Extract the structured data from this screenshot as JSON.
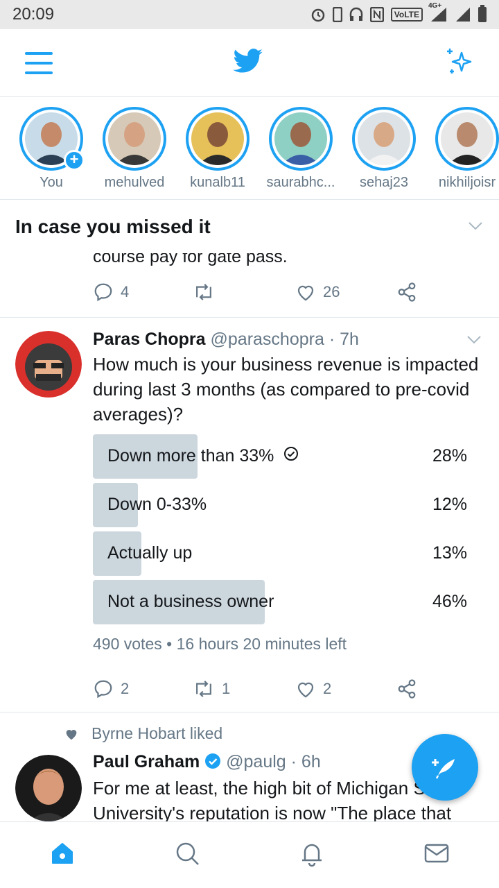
{
  "status_bar": {
    "time": "20:09",
    "network": "4G+",
    "volte": "VoLTE"
  },
  "fleets": [
    {
      "name": "You",
      "has_add": true,
      "ring": "#1da1f2",
      "bg": "#c8dbe8",
      "skin": "#c48a6a",
      "shirt": "#2b3f55"
    },
    {
      "name": "mehulved",
      "has_add": false,
      "ring": "#1da1f2",
      "bg": "#d6c9b7",
      "skin": "#d5a383",
      "shirt": "#383838"
    },
    {
      "name": "kunalb11",
      "has_add": false,
      "ring": "#1da1f2",
      "bg": "#e6c15a",
      "skin": "#8a5a3c",
      "shirt": "#2a2a2a"
    },
    {
      "name": "saurabhc...",
      "has_add": false,
      "ring": "#1da1f2",
      "bg": "#8fd0c5",
      "skin": "#9a6a4f",
      "shirt": "#3b5fa7"
    },
    {
      "name": "sehaj23",
      "has_add": false,
      "ring": "#1da1f2",
      "bg": "#dde2e6",
      "skin": "#d8a987",
      "shirt": "#f2f2f2"
    },
    {
      "name": "nikhiljoisr",
      "has_add": false,
      "ring": "#1da1f2",
      "bg": "#e8e8e8",
      "skin": "#b98a6d",
      "shirt": "#222222"
    }
  ],
  "icymi": {
    "title": "In case you missed it"
  },
  "prev_tweet": {
    "text_fragment": "course pay for gate pass.",
    "replies": "4",
    "retweets": "",
    "likes": "26"
  },
  "poll_tweet": {
    "name": "Paras Chopra",
    "handle": "@paraschopra",
    "time": "· 7h",
    "text": "How much is your business revenue is impacted during last 3 months (as compared to pre-covid averages)?",
    "options": [
      {
        "label": "Down more than 33%",
        "pct": "28%",
        "fraction": 0.28,
        "winner": true
      },
      {
        "label": "Down 0-33%",
        "pct": "12%",
        "fraction": 0.12,
        "winner": false
      },
      {
        "label": "Actually up",
        "pct": "13%",
        "fraction": 0.13,
        "winner": false
      },
      {
        "label": "Not a business owner",
        "pct": "46%",
        "fraction": 0.46,
        "winner": false
      }
    ],
    "votes": "490 votes",
    "time_left": "16 hours 20 minutes left",
    "replies": "2",
    "retweets": "1",
    "likes": "2"
  },
  "liked_tweet": {
    "liked_by": "Byrne Hobart liked",
    "name": "Paul Graham",
    "handle": "@paulg",
    "time": "· 6h",
    "text": "For me at least, the high bit of Michigan State University's reputation is now \"The place that"
  },
  "colors": {
    "accent": "#1da1f2",
    "secondary_text": "#657786",
    "poll_fill": "#ccd6dd",
    "divider": "#e1e8ed"
  }
}
